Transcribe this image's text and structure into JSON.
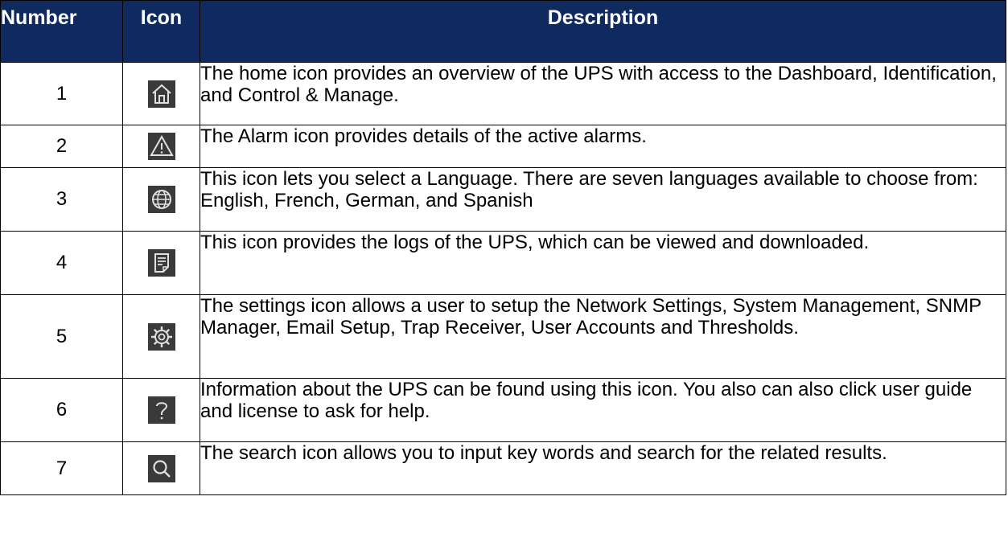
{
  "headers": {
    "number": "Number",
    "icon": "Icon",
    "description": "Description"
  },
  "rows": [
    {
      "number": "1",
      "icon": "home-icon",
      "description": "The home icon provides an overview of the UPS with access to the Dashboard, Identification, and Control & Manage."
    },
    {
      "number": "2",
      "icon": "alarm-icon",
      "description": "The Alarm icon provides details of the active alarms."
    },
    {
      "number": "3",
      "icon": "globe-icon",
      "description": "This icon lets you select a Language. There are seven languages available to choose from: English, French, German, and Spanish"
    },
    {
      "number": "4",
      "icon": "log-icon",
      "description": "This icon provides the logs of the UPS, which can be viewed and downloaded."
    },
    {
      "number": "5",
      "icon": "gear-icon",
      "description": "The settings icon allows a user to setup the Network Settings, System Management, SNMP Manager, Email Setup, Trap Receiver, User Accounts and Thresholds."
    },
    {
      "number": "6",
      "icon": "help-icon",
      "description": "Information about the UPS can be found using this icon. You also can also click user guide and license to ask for help."
    },
    {
      "number": "7",
      "icon": "search-icon",
      "description": "The search icon allows you to input key words and search for the related results."
    }
  ],
  "colors": {
    "header_bg": "#0e2a5e",
    "header_text": "#ffffff",
    "icon_bg": "#3a3a3a",
    "icon_fg": "#e0e0e0"
  }
}
